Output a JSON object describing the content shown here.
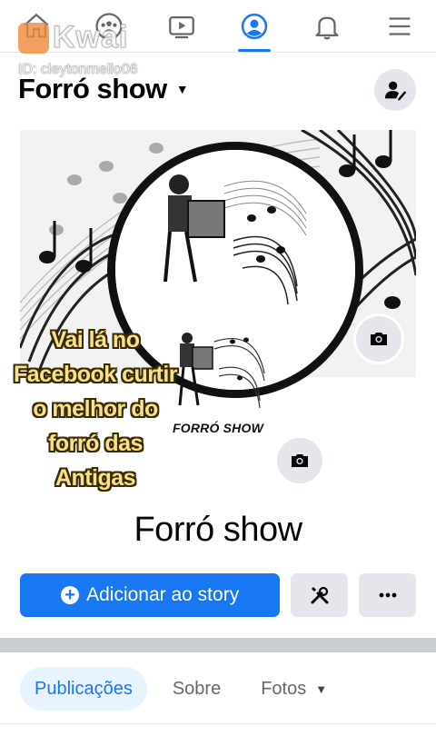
{
  "watermark": {
    "brand": "Kwai",
    "id": "ID: cleytonmello06"
  },
  "nav": {
    "items": [
      {
        "name": "home",
        "active": false
      },
      {
        "name": "groups",
        "active": false
      },
      {
        "name": "watch",
        "active": false
      },
      {
        "name": "profile",
        "active": true
      },
      {
        "name": "notifications",
        "active": false
      },
      {
        "name": "menu",
        "active": false
      }
    ]
  },
  "header": {
    "title": "Forró show"
  },
  "overlay": {
    "lines": [
      "Vai lá no",
      "Facebook curtir",
      "o melhor do",
      "forró das",
      "Antigas"
    ]
  },
  "logo_text": "FORRÓ SHOW",
  "page_name": "Forró show",
  "actions": {
    "primary_label": "Adicionar ao story"
  },
  "tabs": [
    {
      "label": "Publicações",
      "active": true
    },
    {
      "label": "Sobre",
      "active": false
    },
    {
      "label": "Fotos",
      "active": false
    }
  ],
  "colors": {
    "accent": "#1877f2",
    "tab_active_bg": "#e7f3ff",
    "button_gray": "#e4e6eb",
    "caption": "#f5e28a"
  }
}
